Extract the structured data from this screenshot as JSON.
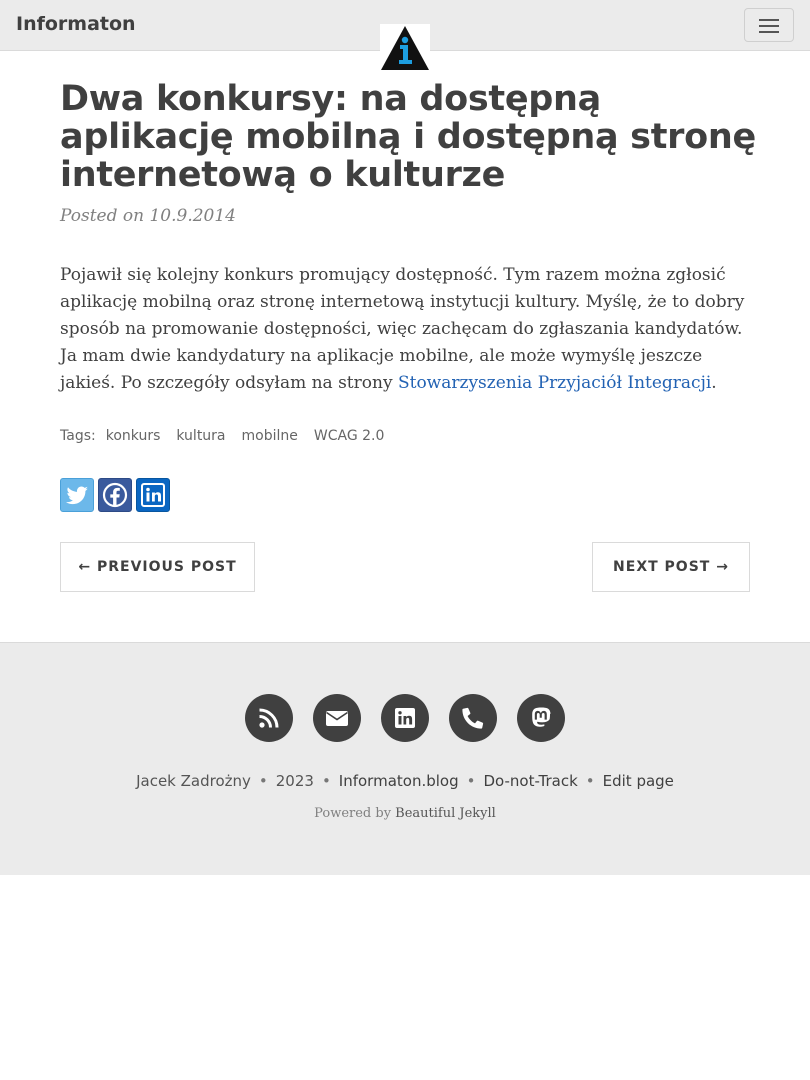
{
  "navbar": {
    "brand": "Informaton",
    "logo_icon": "info-logo-icon",
    "menu_icon": "hamburger-menu-icon"
  },
  "post": {
    "title": "Dwa konkursy: na dostępną aplikację mobilną i dostępną stronę internetową o kulturze",
    "meta": "Posted on 10.9.2014",
    "body_text": "Pojawił się kolejny konkurs promujący dostępność. Tym razem można zgłosić aplikację mobilną oraz stronę internetową instytucji kultury. Myślę, że to dobry sposób na promowanie dostępności, więc zachęcam do zgłaszania kandydatów. Ja mam dwie kandydatury na aplikacje mobilne, ale może wymyślę jeszcze jakieś. Po szczegóły odsyłam na strony ",
    "link_text": "Stowarzyszenia Przyjaciół Integracji",
    "body_end": "."
  },
  "tags": {
    "label": "Tags:",
    "items": [
      "konkurs",
      "kultura",
      "mobilne",
      "WCAG 2.0"
    ]
  },
  "share": {
    "icons": [
      "twitter-icon",
      "facebook-icon",
      "linkedin-icon"
    ]
  },
  "pager": {
    "prev_label": "← PREVIOUS POST",
    "next_label": "NEXT POST →"
  },
  "footer": {
    "social_icons": [
      "rss-icon",
      "email-icon",
      "linkedin-icon",
      "phone-icon",
      "mastodon-icon"
    ],
    "author": "Jacek Zadrożny",
    "year": "2023",
    "site": "Informaton.blog",
    "dnt": "Do-not-Track",
    "edit": "Edit page",
    "powered_prefix": "Powered by ",
    "powered_link": "Beautiful Jekyll",
    "separator": "•"
  },
  "colors": {
    "navbar_bg": "#ebebeb",
    "text": "#404040",
    "link": "#2262b3",
    "twitter": "#6cb8ea",
    "facebook": "#3a5a9d",
    "linkedin": "#0a66c2",
    "logo_blue": "#1d9ee0"
  }
}
